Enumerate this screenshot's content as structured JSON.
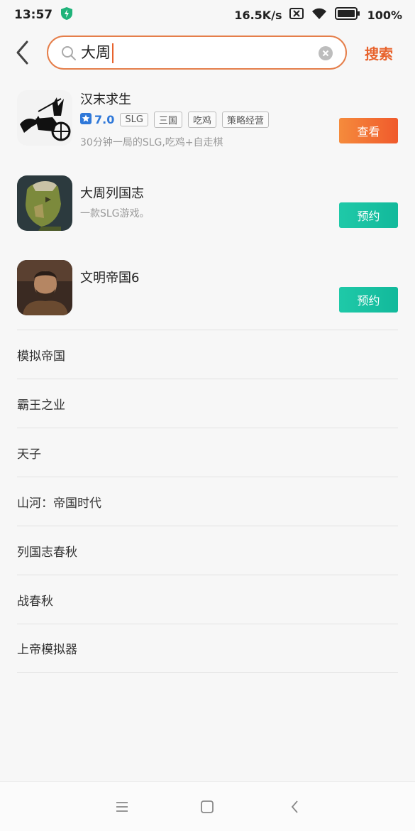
{
  "status": {
    "time": "13:57",
    "speed": "16.5K/s",
    "battery": "100%"
  },
  "search": {
    "query": "大周",
    "button": "搜索"
  },
  "games": [
    {
      "title": "汉末求生",
      "rating": "7.0",
      "tags": [
        "SLG",
        "三国",
        "吃鸡",
        "策略经营"
      ],
      "desc": "30分钟一局的SLG,吃鸡+自走棋",
      "action": "查看"
    },
    {
      "title": "大周列国志",
      "desc": "一款SLG游戏。",
      "action": "预约"
    },
    {
      "title": "文明帝国6",
      "action": "预约"
    }
  ],
  "suggestions": [
    "模拟帝国",
    "霸王之业",
    "天子",
    "山河：帝国时代",
    "列国志春秋",
    "战春秋",
    "上帝模拟器"
  ],
  "colors": {
    "accent": "#e8632d",
    "rating": "#2f78d9",
    "reserve": "#12b99b"
  }
}
